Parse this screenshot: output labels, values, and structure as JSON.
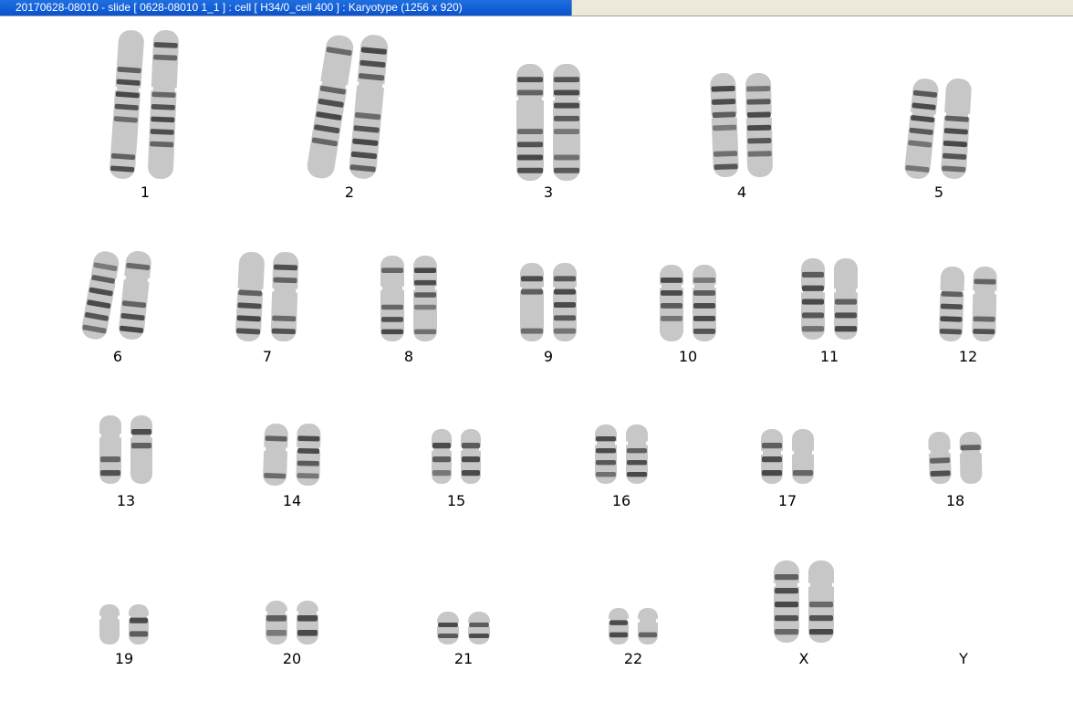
{
  "window": {
    "title": "20170628-08010 - slide [ 0628-08010 1_1 ] : cell [ H34/0_cell 400 ] : Karyotype  (1256 x 920)"
  },
  "karyotype": {
    "groups": [
      {
        "label": "1",
        "chromatids": 2
      },
      {
        "label": "2",
        "chromatids": 2
      },
      {
        "label": "3",
        "chromatids": 2
      },
      {
        "label": "4",
        "chromatids": 2
      },
      {
        "label": "5",
        "chromatids": 2
      },
      {
        "label": "6",
        "chromatids": 2
      },
      {
        "label": "7",
        "chromatids": 2
      },
      {
        "label": "8",
        "chromatids": 2
      },
      {
        "label": "9",
        "chromatids": 2
      },
      {
        "label": "10",
        "chromatids": 2
      },
      {
        "label": "11",
        "chromatids": 2
      },
      {
        "label": "12",
        "chromatids": 2
      },
      {
        "label": "13",
        "chromatids": 2
      },
      {
        "label": "14",
        "chromatids": 2
      },
      {
        "label": "15",
        "chromatids": 2
      },
      {
        "label": "16",
        "chromatids": 2
      },
      {
        "label": "17",
        "chromatids": 2
      },
      {
        "label": "18",
        "chromatids": 2
      },
      {
        "label": "19",
        "chromatids": 2
      },
      {
        "label": "20",
        "chromatids": 2
      },
      {
        "label": "21",
        "chromatids": 2
      },
      {
        "label": "22",
        "chromatids": 2
      },
      {
        "label": "X",
        "chromatids": 2
      },
      {
        "label": "Y",
        "chromatids": 0
      }
    ]
  },
  "colors": {
    "title_bar": "#0a52cf",
    "chromosome_light": "#bdbdbd",
    "chromosome_dark": "#3a3a3a"
  }
}
